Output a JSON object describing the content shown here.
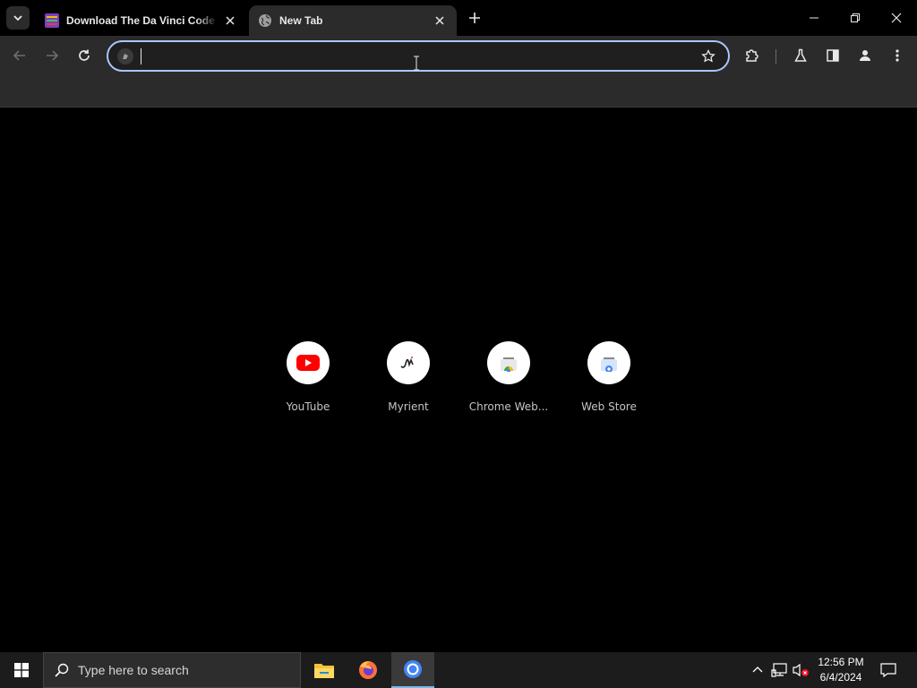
{
  "browser": {
    "tabs": [
      {
        "title": "Download The Da Vinci Code (",
        "active": false
      },
      {
        "title": "New Tab",
        "active": true
      }
    ],
    "omnibox": {
      "value": "",
      "placeholder": ""
    },
    "accent_color": "#a8c7fa"
  },
  "new_tab_page": {
    "shortcuts": [
      {
        "label": "YouTube",
        "icon": "youtube-icon"
      },
      {
        "label": "Myrient",
        "icon": "myrient-icon"
      },
      {
        "label": "Chrome Web...",
        "icon": "chrome-web-store-icon"
      },
      {
        "label": "Web Store",
        "icon": "web-store-icon"
      }
    ]
  },
  "taskbar": {
    "search_placeholder": "Type here to search",
    "apps": [
      "file-explorer-icon",
      "firefox-icon",
      "chrome-icon"
    ],
    "clock": {
      "time": "12:56 PM",
      "date": "6/4/2024"
    }
  }
}
